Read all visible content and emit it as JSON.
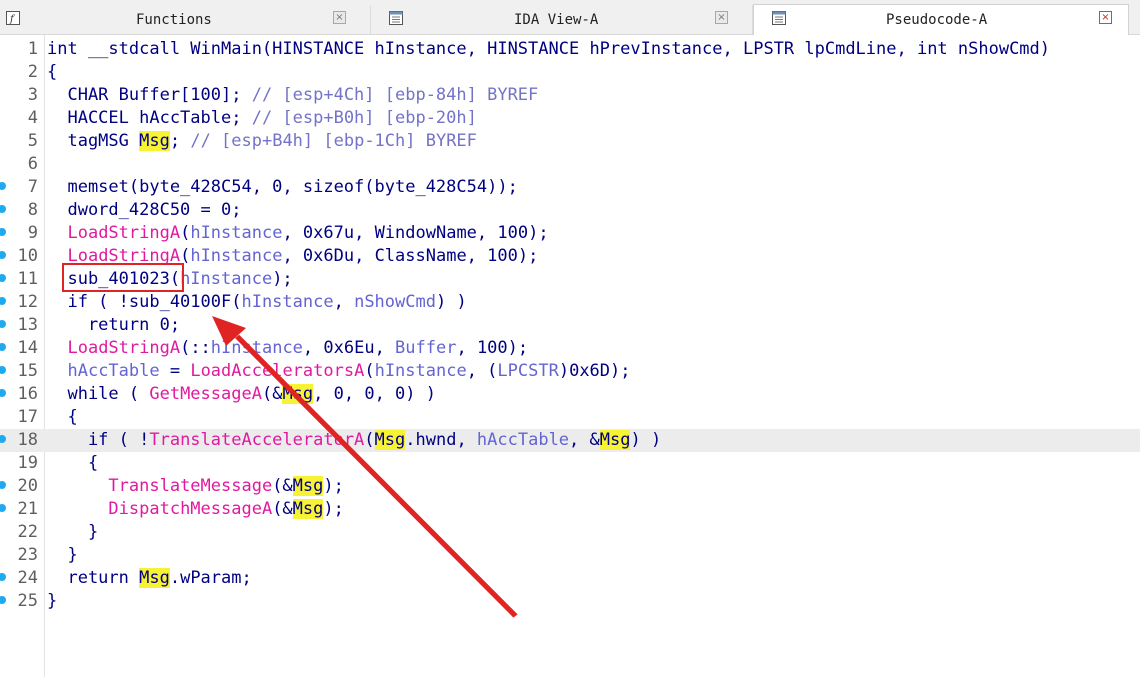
{
  "tabs": [
    {
      "label": "Functions",
      "icon": "function-icon"
    },
    {
      "label": "IDA View-A",
      "icon": "list-view-icon"
    },
    {
      "label": "Pseudocode-A",
      "icon": "list-view-icon",
      "active": true
    }
  ],
  "close_glyph": "×",
  "colors": {
    "keyword": "#000082",
    "comment": "#7373c8",
    "import_function": "#e01aa0",
    "variable": "#6464d2",
    "highlight": "#f7f233",
    "annotation": "#e02424",
    "breakpoint_dot": "#1eaaf1"
  },
  "current_line": 18,
  "annotation": {
    "box_text": "sub_401023",
    "arrow_points_to_line": 11
  },
  "lines": [
    {
      "n": "1",
      "dot": false,
      "tokens": [
        [
          "k",
          "int __stdcall WinMain(HINSTANCE hInstance, HINSTANCE hPrevInstance, LPSTR lpCmdLine, int nShowCmd)"
        ]
      ]
    },
    {
      "n": "2",
      "dot": false,
      "tokens": [
        [
          "k",
          "{"
        ]
      ]
    },
    {
      "n": "3",
      "dot": false,
      "tokens": [
        [
          "k",
          "  CHAR Buffer[100]; "
        ],
        [
          "c",
          "// [esp+4Ch] [ebp-84h] BYREF"
        ]
      ]
    },
    {
      "n": "4",
      "dot": false,
      "tokens": [
        [
          "k",
          "  HACCEL hAccTable; "
        ],
        [
          "c",
          "// [esp+B0h] [ebp-20h]"
        ]
      ]
    },
    {
      "n": "5",
      "dot": false,
      "tokens": [
        [
          "k",
          "  tagMSG "
        ],
        [
          "h",
          "Msg"
        ],
        [
          "k",
          "; "
        ],
        [
          "c",
          "// [esp+B4h] [ebp-1Ch] BYREF"
        ]
      ]
    },
    {
      "n": "6",
      "dot": false,
      "tokens": []
    },
    {
      "n": "7",
      "dot": true,
      "tokens": [
        [
          "k",
          "  memset(byte_428C54, 0, sizeof(byte_428C54));"
        ]
      ]
    },
    {
      "n": "8",
      "dot": true,
      "tokens": [
        [
          "k",
          "  dword_428C50 = 0;"
        ]
      ]
    },
    {
      "n": "9",
      "dot": true,
      "tokens": [
        [
          "k",
          "  "
        ],
        [
          "f",
          "LoadStringA"
        ],
        [
          "k",
          "("
        ],
        [
          "v",
          "hInstance"
        ],
        [
          "k",
          ", 0x67u, WindowName, 100);"
        ]
      ]
    },
    {
      "n": "10",
      "dot": true,
      "tokens": [
        [
          "k",
          "  "
        ],
        [
          "f",
          "LoadStringA"
        ],
        [
          "k",
          "("
        ],
        [
          "v",
          "hInstance"
        ],
        [
          "k",
          ", 0x6Du, ClassName, 100);"
        ]
      ]
    },
    {
      "n": "11",
      "dot": true,
      "tokens": [
        [
          "k",
          "  sub_401023("
        ],
        [
          "v",
          "hInstance"
        ],
        [
          "k",
          ");"
        ]
      ]
    },
    {
      "n": "12",
      "dot": true,
      "tokens": [
        [
          "k",
          "  if ( !sub_40100F("
        ],
        [
          "v",
          "hInstance"
        ],
        [
          "k",
          ", "
        ],
        [
          "v",
          "nShowCmd"
        ],
        [
          "k",
          ") )"
        ]
      ]
    },
    {
      "n": "13",
      "dot": true,
      "tokens": [
        [
          "k",
          "    return 0;"
        ]
      ]
    },
    {
      "n": "14",
      "dot": true,
      "tokens": [
        [
          "k",
          "  "
        ],
        [
          "f",
          "LoadStringA"
        ],
        [
          "k",
          "(::"
        ],
        [
          "v",
          "hInstance"
        ],
        [
          "k",
          ", 0x6Eu, "
        ],
        [
          "v",
          "Buffer"
        ],
        [
          "k",
          ", 100);"
        ]
      ]
    },
    {
      "n": "15",
      "dot": true,
      "tokens": [
        [
          "k",
          "  "
        ],
        [
          "v",
          "hAccTable"
        ],
        [
          "k",
          " = "
        ],
        [
          "f",
          "LoadAcceleratorsA"
        ],
        [
          "k",
          "("
        ],
        [
          "v",
          "hInstance"
        ],
        [
          "k",
          ", ("
        ],
        [
          "v",
          "LPCSTR"
        ],
        [
          "k",
          ")0x6D);"
        ]
      ]
    },
    {
      "n": "16",
      "dot": true,
      "tokens": [
        [
          "k",
          "  while ( "
        ],
        [
          "f",
          "GetMessageA"
        ],
        [
          "k",
          "(&"
        ],
        [
          "h",
          "Msg"
        ],
        [
          "k",
          ", 0, 0, 0) )"
        ]
      ]
    },
    {
      "n": "17",
      "dot": false,
      "tokens": [
        [
          "k",
          "  {"
        ]
      ]
    },
    {
      "n": "18",
      "dot": true,
      "tokens": [
        [
          "k",
          "    if ( !"
        ],
        [
          "f",
          "TranslateAcceleratorA"
        ],
        [
          "k",
          "("
        ],
        [
          "h",
          "Msg"
        ],
        [
          "k",
          ".hwnd, "
        ],
        [
          "v",
          "hAccTable"
        ],
        [
          "k",
          ", &"
        ],
        [
          "h",
          "Msg"
        ],
        [
          "k",
          ") )"
        ]
      ]
    },
    {
      "n": "19",
      "dot": false,
      "tokens": [
        [
          "k",
          "    {"
        ]
      ]
    },
    {
      "n": "20",
      "dot": true,
      "tokens": [
        [
          "k",
          "      "
        ],
        [
          "f",
          "TranslateMessage"
        ],
        [
          "k",
          "(&"
        ],
        [
          "h",
          "Msg"
        ],
        [
          "k",
          ");"
        ]
      ]
    },
    {
      "n": "21",
      "dot": true,
      "tokens": [
        [
          "k",
          "      "
        ],
        [
          "f",
          "DispatchMessageA"
        ],
        [
          "k",
          "(&"
        ],
        [
          "h",
          "Msg"
        ],
        [
          "k",
          ");"
        ]
      ]
    },
    {
      "n": "22",
      "dot": false,
      "tokens": [
        [
          "k",
          "    }"
        ]
      ]
    },
    {
      "n": "23",
      "dot": false,
      "tokens": [
        [
          "k",
          "  }"
        ]
      ]
    },
    {
      "n": "24",
      "dot": true,
      "tokens": [
        [
          "k",
          "  return "
        ],
        [
          "h",
          "Msg"
        ],
        [
          "k",
          ".wParam;"
        ]
      ]
    },
    {
      "n": "25",
      "dot": true,
      "tokens": [
        [
          "k",
          "}"
        ]
      ]
    }
  ]
}
